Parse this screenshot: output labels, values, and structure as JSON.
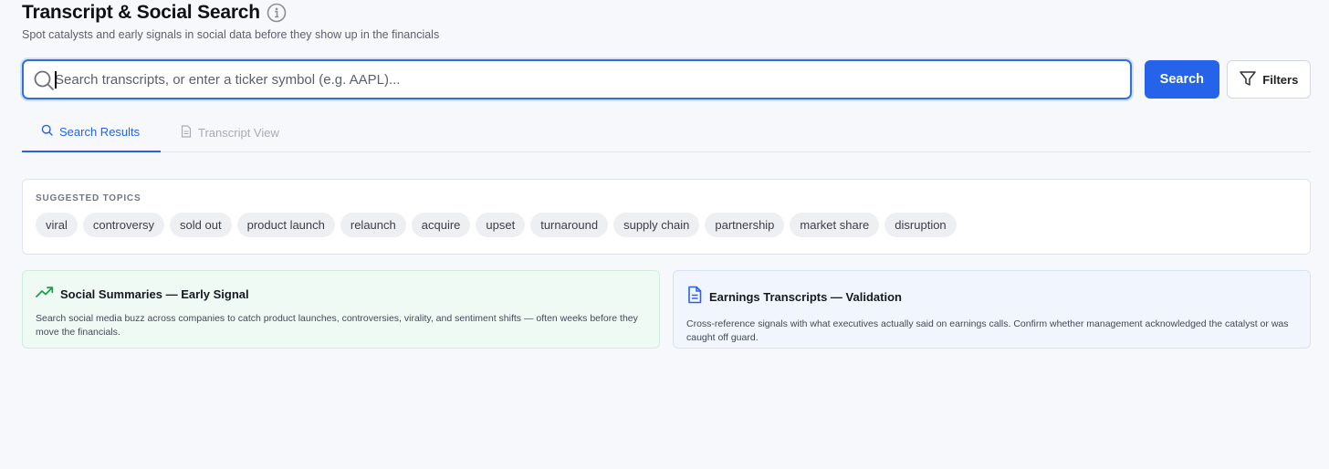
{
  "header": {
    "title": "Transcript & Social Search",
    "subtitle": "Spot catalysts and early signals in social data before they show up in the financials"
  },
  "search": {
    "placeholder": "Search transcripts, or enter a ticker symbol (e.g. AAPL)...",
    "value": "",
    "search_label": "Search",
    "filters_label": "Filters"
  },
  "tabs": [
    {
      "label": "Search Results",
      "icon": "search-icon",
      "active": true
    },
    {
      "label": "Transcript View",
      "icon": "document-icon",
      "active": false
    }
  ],
  "topics": {
    "label": "SUGGESTED TOPICS",
    "items": [
      "viral",
      "controversy",
      "sold out",
      "product launch",
      "relaunch",
      "acquire",
      "upset",
      "turnaround",
      "supply chain",
      "partnership",
      "market share",
      "disruption"
    ]
  },
  "cards": [
    {
      "title": "Social Summaries — Early Signal",
      "icon": "trending-up-icon",
      "text": "Search social media buzz across companies to catch product launches, controversies, virality, and sentiment shifts — often weeks before they move the financials.",
      "color": "#16a34a"
    },
    {
      "title": "Earnings Transcripts — Validation",
      "icon": "document-icon",
      "text": "Cross-reference signals with what executives actually said on earnings calls. Confirm whether management acknowledged the catalyst or was caught off guard.",
      "color": "#2563eb"
    }
  ],
  "colors": {
    "accent": "#2563eb",
    "background": "#f7f8fb"
  }
}
